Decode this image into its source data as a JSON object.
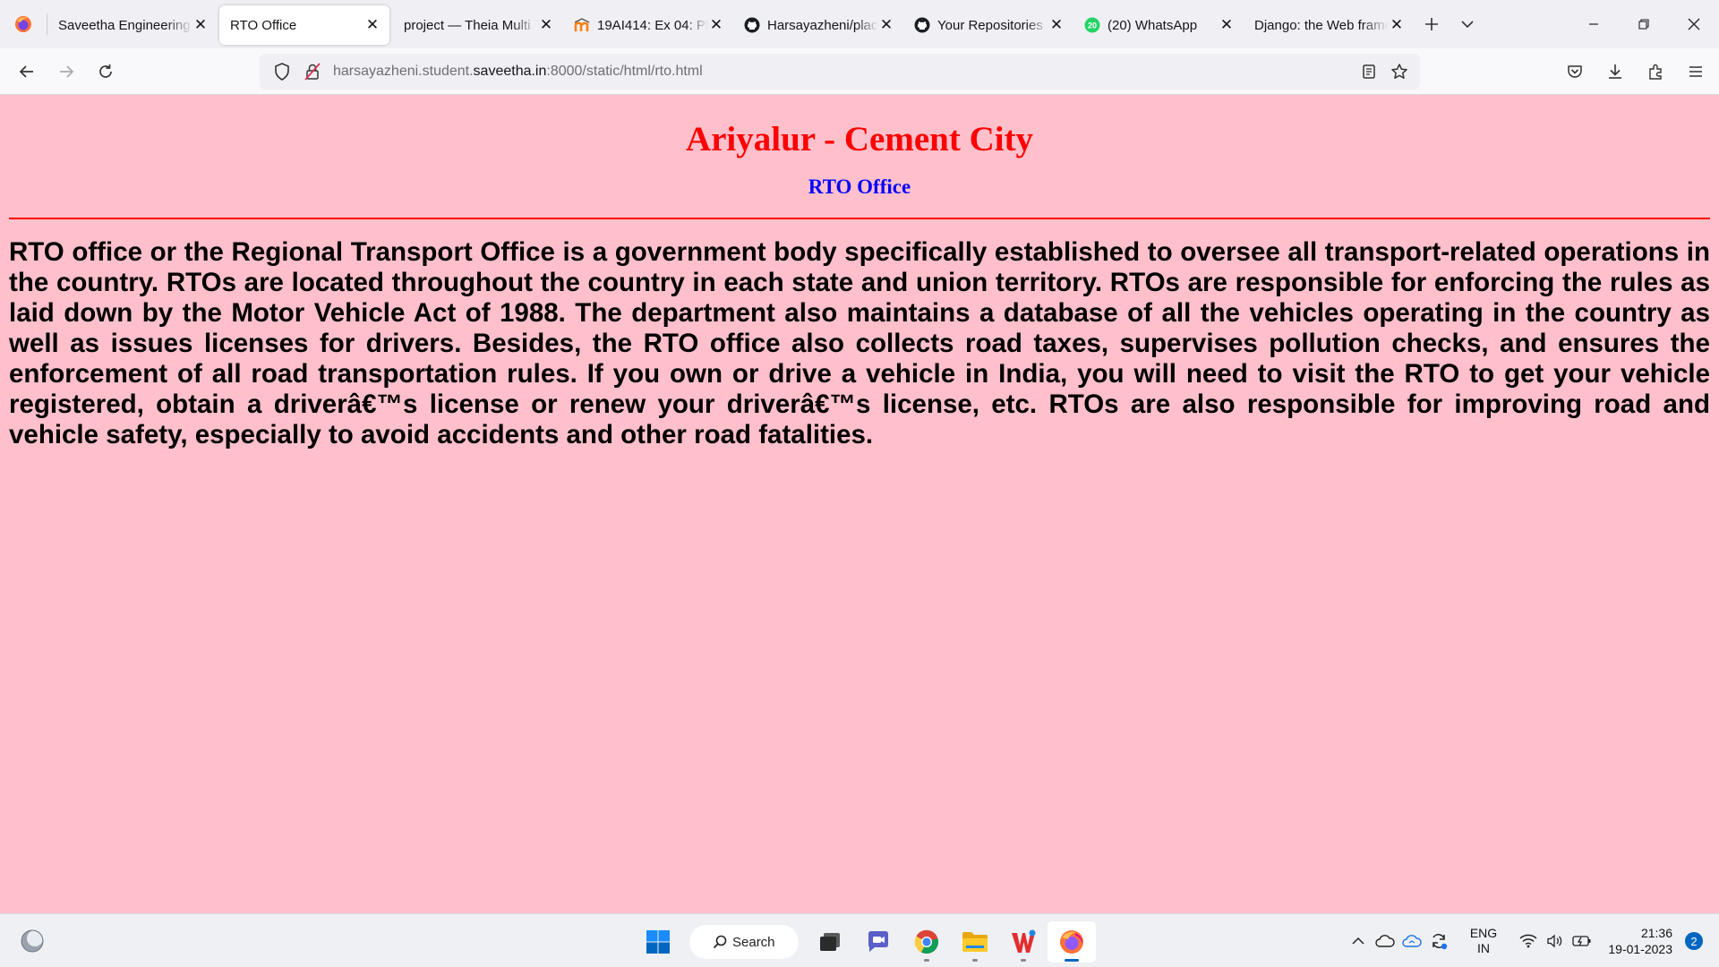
{
  "browser": {
    "tabs": [
      {
        "title": "Saveetha Engineering",
        "active": false,
        "icon": "globe-icon"
      },
      {
        "title": "RTO Office",
        "active": true,
        "icon": "none"
      },
      {
        "title": "project — Theia Multi",
        "active": false,
        "icon": "none"
      },
      {
        "title": "19AI414: Ex 04: Pla",
        "active": false,
        "icon": "moodle-icon"
      },
      {
        "title": "Harsayazheni/plac",
        "active": false,
        "icon": "github-icon"
      },
      {
        "title": "Your Repositories",
        "active": false,
        "icon": "github-icon"
      },
      {
        "title": "(20) WhatsApp",
        "active": false,
        "icon": "whatsapp-icon",
        "badge": "20"
      },
      {
        "title": "Django: the Web frame",
        "active": false,
        "icon": "none"
      }
    ],
    "url": {
      "prefix": "harsayazheni.student.",
      "host": "saveetha.in",
      "suffix": ":8000/static/html/rto.html"
    }
  },
  "page": {
    "heading": "Ariyalur - Cement City",
    "subheading": "RTO Office",
    "paragraph": "RTO office or the Regional Transport Office is a government body specifically established to oversee all transport-related operations in the country. RTOs are located throughout the country in each state and union territory. RTOs are responsible for enforcing the rules as laid down by the Motor Vehicle Act of 1988. The department also maintains a database of all the vehicles operating in the country as well as issues licenses for drivers. Besides, the RTO office also collects road taxes, supervises pollution checks, and ensures the enforcement of all road transportation rules. If you own or drive a vehicle in India, you will need to visit the RTO to get your vehicle registered, obtain a driverâ€™s license or renew your driverâ€™s license, etc. RTOs are also responsible for improving road and vehicle safety, especially to avoid accidents and other road fatalities.",
    "colors": {
      "background": "#ffc0cb",
      "heading": "#ff0000",
      "subheading": "#0000ff",
      "rule": "#ff0000"
    }
  },
  "taskbar": {
    "search_label": "Search",
    "lang_line1": "ENG",
    "lang_line2": "IN",
    "time": "21:36",
    "date": "19-01-2023",
    "notification_count": "2"
  }
}
